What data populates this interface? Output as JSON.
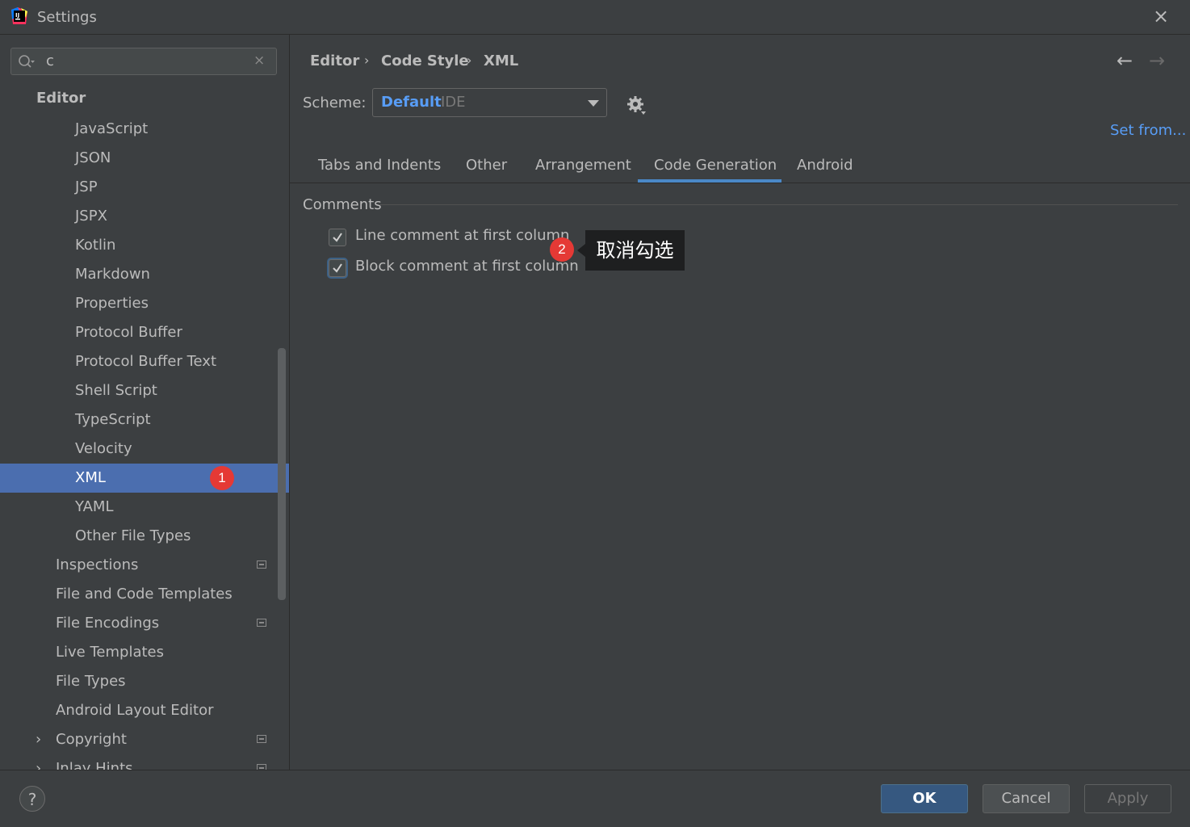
{
  "window": {
    "title": "Settings",
    "close_glyph": "×"
  },
  "search": {
    "value": "c",
    "clear_glyph": "×"
  },
  "sidebar": {
    "items": [
      {
        "label": "Editor"
      },
      {
        "label": "JavaScript"
      },
      {
        "label": "JSON"
      },
      {
        "label": "JSP"
      },
      {
        "label": "JSPX"
      },
      {
        "label": "Kotlin"
      },
      {
        "label": "Markdown"
      },
      {
        "label": "Properties"
      },
      {
        "label": "Protocol Buffer"
      },
      {
        "label": "Protocol Buffer Text"
      },
      {
        "label": "Shell Script"
      },
      {
        "label": "TypeScript"
      },
      {
        "label": "Velocity"
      },
      {
        "label": "XML"
      },
      {
        "label": "YAML"
      },
      {
        "label": "Other File Types"
      },
      {
        "label": "Inspections"
      },
      {
        "label": "File and Code Templates"
      },
      {
        "label": "File Encodings"
      },
      {
        "label": "Live Templates"
      },
      {
        "label": "File Types"
      },
      {
        "label": "Android Layout Editor"
      },
      {
        "label": "Copyright"
      },
      {
        "label": "Inlay Hints"
      }
    ],
    "chevron": "›"
  },
  "annotations": {
    "step1": "1",
    "step2": "2",
    "tooltip": "取消勾选"
  },
  "breadcrumb": {
    "items": [
      "Editor",
      "Code Style",
      "XML"
    ],
    "sep": "›"
  },
  "nav": {
    "back": "←",
    "forward": "→"
  },
  "scheme": {
    "label": "Scheme:",
    "name": "Default",
    "kind": "IDE"
  },
  "set_from": "Set from...",
  "tabs": [
    "Tabs and Indents",
    "Other",
    "Arrangement",
    "Code Generation",
    "Android"
  ],
  "active_tab": "Code Generation",
  "comments": {
    "title": "Comments",
    "line_comment": {
      "label": "Line comment at first column",
      "checked": true
    },
    "block_comment": {
      "label": "Block comment at first column",
      "checked": true
    }
  },
  "footer": {
    "help": "?",
    "ok": "OK",
    "cancel": "Cancel",
    "apply": "Apply"
  },
  "colors": {
    "accent": "#4b6eaf",
    "link": "#589df6",
    "annotation": "#e53935",
    "tab_underline": "#4a88c7"
  }
}
